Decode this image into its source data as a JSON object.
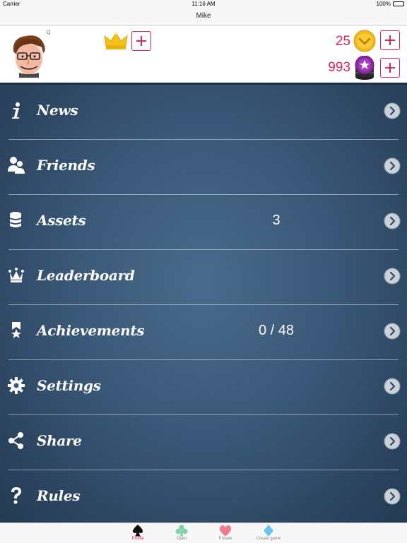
{
  "status_bar": {
    "carrier": "Carrier",
    "time": "11:16 AM",
    "battery": "100%"
  },
  "nav": {
    "title": "Mike"
  },
  "profile": {
    "avatar_badge": "Q",
    "coins": "25",
    "chips": "993"
  },
  "menu": [
    {
      "label": "News",
      "icon": "info-icon",
      "value": ""
    },
    {
      "label": "Friends",
      "icon": "friends-icon",
      "value": ""
    },
    {
      "label": "Assets",
      "icon": "coin-stack-icon",
      "value": "3"
    },
    {
      "label": "Leaderboard",
      "icon": "crown-icon",
      "value": ""
    },
    {
      "label": "Achievements",
      "icon": "ribbon-star-icon",
      "value": "0 / 48"
    },
    {
      "label": "Settings",
      "icon": "gear-icon",
      "value": ""
    },
    {
      "label": "Share",
      "icon": "share-icon",
      "value": ""
    },
    {
      "label": "Rules",
      "icon": "question-icon",
      "value": ""
    }
  ],
  "tabs": [
    {
      "label": "Profile",
      "icon": "spade-icon",
      "active": true
    },
    {
      "label": "Open",
      "icon": "club-icon",
      "active": false
    },
    {
      "label": "Private",
      "icon": "heart-icon",
      "active": false
    },
    {
      "label": "Create game",
      "icon": "diamond-icon",
      "active": false
    }
  ],
  "colors": {
    "accent": "#e0245e",
    "menu_bg": "#3a5878",
    "club": "#7ed3a6",
    "heart": "#f07a8e",
    "diamond": "#6ac4f0"
  }
}
